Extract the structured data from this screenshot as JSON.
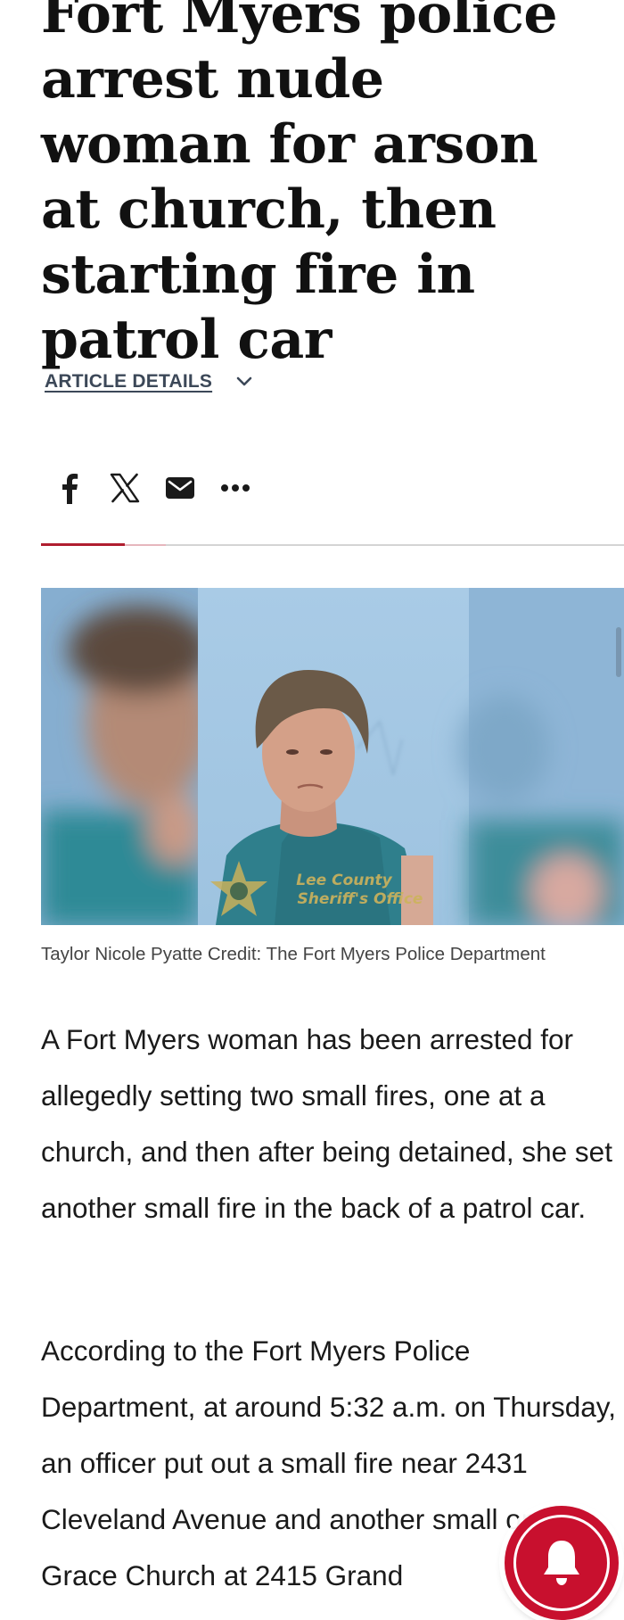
{
  "article": {
    "headline": "Fort Myers police arrest nude woman for arson at church, then starting fire in patrol car",
    "details_label": "ARTICLE DETAILS",
    "share_icons": [
      "facebook-icon",
      "x-icon",
      "email-icon",
      "more-icon"
    ],
    "photo": {
      "watermark_line1": "Lee County",
      "watermark_line2": "Sheriff's Office"
    },
    "caption": "Taylor Nicole Pyatte Credit: The Fort Myers Police Department",
    "paragraphs": [
      "A Fort Myers woman has been arrested for allegedly setting two small fires, one at a church, and then after being detained, she set another small fire in the back of a patrol car.",
      "According to the Fort Myers Police Department, at around 5:32 a.m. on Thursday, an officer put out a small fire near 2431 Cleveland Avenue and another small one at Grace Church at 2415 Grand"
    ]
  },
  "colors": {
    "accent": "#b01e2f",
    "bell": "#c8102e",
    "details_text": "#3c4858"
  }
}
